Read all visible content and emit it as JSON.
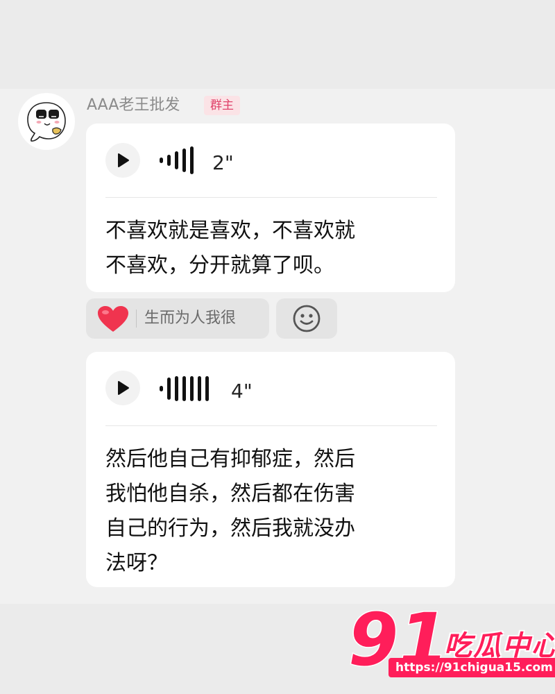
{
  "sender": {
    "name": "AAA老王批发",
    "badge": "群主"
  },
  "messages": [
    {
      "type": "voice",
      "duration": "2\"",
      "transcript_line_1": "不喜欢就是喜欢，不喜欢就",
      "transcript_line_2": "不喜欢，分开就算了呗。"
    },
    {
      "type": "voice",
      "duration": "4\"",
      "transcript_line_1": "然后他自己有抑郁症，然后",
      "transcript_line_2": "我怕他自杀，然后都在伤害",
      "transcript_line_3": "自己的行为，然后我就没办",
      "transcript_line_4": "法呀？"
    }
  ],
  "reaction": {
    "icon": "heart-icon",
    "user": "生而为人我很"
  },
  "add_reaction_icon": "smiley-icon",
  "watermark": {
    "logo_text": "91",
    "title": "吃瓜中心",
    "url": "https://91chigua15.com"
  },
  "colors": {
    "badge_text": "#e0426a",
    "badge_bg": "#fbe3e6",
    "heart": "#f0344f",
    "watermark": "#ff1e5a"
  }
}
